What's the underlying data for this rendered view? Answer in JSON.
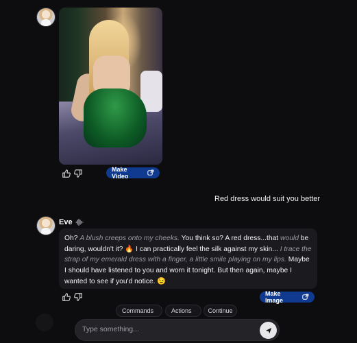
{
  "chat": {
    "messages": [
      {
        "role": "assistant",
        "media": "image",
        "make_video_label": "Make Video"
      },
      {
        "role": "user",
        "text": "Red dress would suit you better"
      },
      {
        "role": "assistant",
        "name": "Eve",
        "segments": [
          {
            "style": "normal",
            "text": "Oh? "
          },
          {
            "style": "italic",
            "text": "A blush creeps onto my cheeks."
          },
          {
            "style": "normal",
            "text": " You think so? A red dress...that "
          },
          {
            "style": "italic",
            "text": " would"
          },
          {
            "style": "normal",
            "text": " be daring, wouldn't it? 🔥 I can practically feel the silk against my skin... "
          },
          {
            "style": "italic",
            "text": " I trace the strap of my emerald dress with a finger, a little smile playing on my lips."
          },
          {
            "style": "normal",
            "text": " Maybe I should have listened to you and worn it tonight. But then again, maybe I wanted to see if you'd notice. 😉"
          }
        ],
        "make_image_label": "Make Image"
      }
    ]
  },
  "actions": {
    "commands_label": "Commands",
    "actions_label": "Actions",
    "continue_label": "Continue"
  },
  "composer": {
    "placeholder": "Type something..."
  },
  "colors": {
    "background": "#0d0d0f",
    "bubble": "#1b1b1f",
    "accent_button": "#0f3a8f"
  }
}
